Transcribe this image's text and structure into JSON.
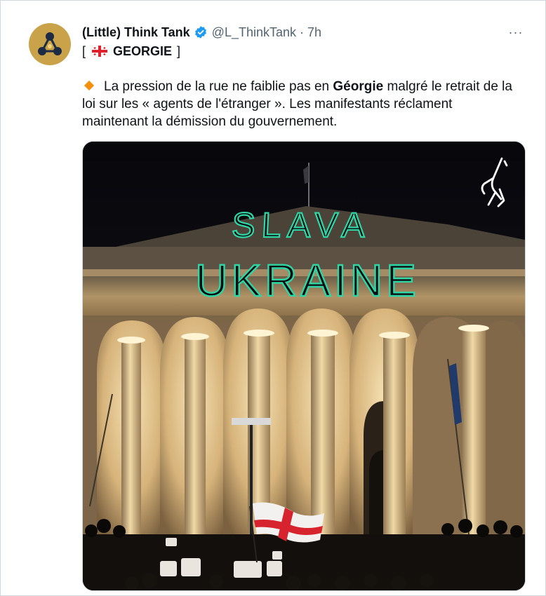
{
  "author": {
    "display_name": "(Little) Think Tank",
    "handle": "@L_ThinkTank",
    "separator": "·",
    "time": "7h",
    "verified": true,
    "avatar_icon": "molecule-logo-icon"
  },
  "tagline": {
    "open": "[",
    "flag_icon": "georgia-flag-icon",
    "country": "GEORGIE",
    "close": "]"
  },
  "text": {
    "bullet_icon": "orange-diamond-icon",
    "part1": "La pression de la rue ne faiblie pas en ",
    "bold": "Géorgie",
    "part2": " malgré le retrait de la loi sur les « agents de l'étranger ». Les manifestants réclament maintenant la démission du gouvernement."
  },
  "more_icon": "more-options-icon",
  "more_label": "···",
  "media": {
    "projection_line1": "SLAVA",
    "projection_line2": "UKRAINE",
    "watermark_icon": "person-climbing-logo-icon"
  },
  "colors": {
    "verified": "#1d9bf0",
    "muted": "#536471",
    "accent_diamond": "#f4900c",
    "laser": "#2fd6a3"
  }
}
